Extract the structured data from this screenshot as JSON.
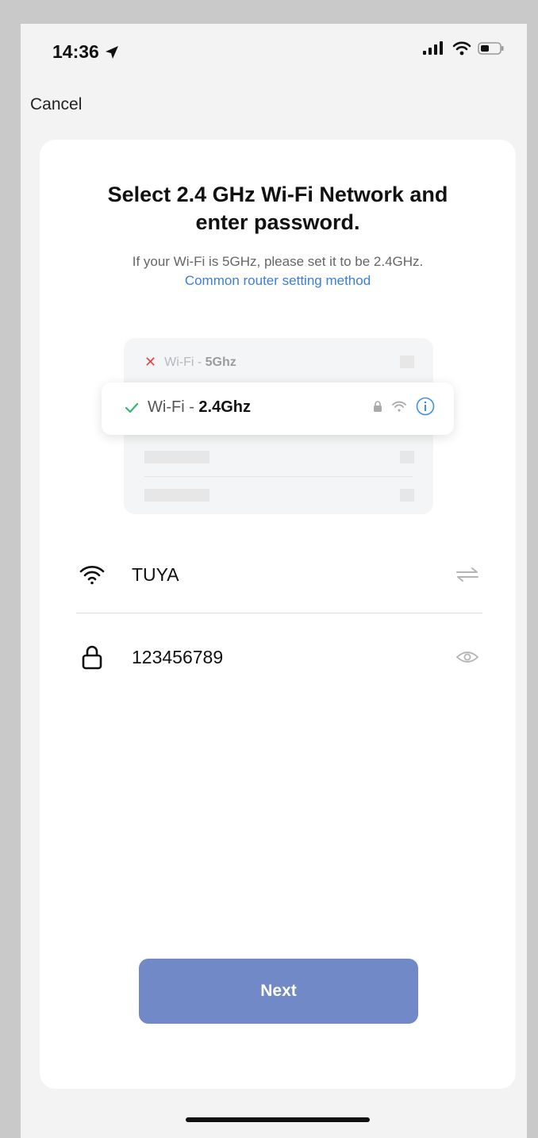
{
  "status_bar": {
    "time": "14:36",
    "location_icon": "location-arrow-icon",
    "signal_icon": "cellular-signal-icon",
    "wifi_icon": "wifi-icon",
    "battery_icon": "battery-icon"
  },
  "nav": {
    "cancel_label": "Cancel"
  },
  "header": {
    "title": "Select 2.4 GHz Wi-Fi Network and enter password.",
    "subtitle": "If your Wi-Fi is 5GHz, please set it to be 2.4GHz.",
    "router_link": "Common router setting method"
  },
  "illustration": {
    "unsupported_prefix": "Wi-Fi - ",
    "unsupported_band": "5Ghz",
    "supported_prefix": "Wi-Fi - ",
    "supported_band": "2.4Ghz",
    "unsupported_mark_icon": "x-mark-icon",
    "supported_mark_icon": "checkmark-icon"
  },
  "form": {
    "network_name": "TUYA",
    "network_leading_icon": "wifi-icon",
    "network_trailing_icon": "switch-arrows-icon",
    "password": "123456789",
    "password_leading_icon": "lock-icon",
    "password_trailing_icon": "eye-icon"
  },
  "actions": {
    "next_label": "Next"
  },
  "colors": {
    "accent": "#7189c6",
    "link": "#3b7ddd",
    "error": "#e8473f",
    "success": "#3cb371",
    "background": "#f3f3f3",
    "card": "#ffffff"
  }
}
